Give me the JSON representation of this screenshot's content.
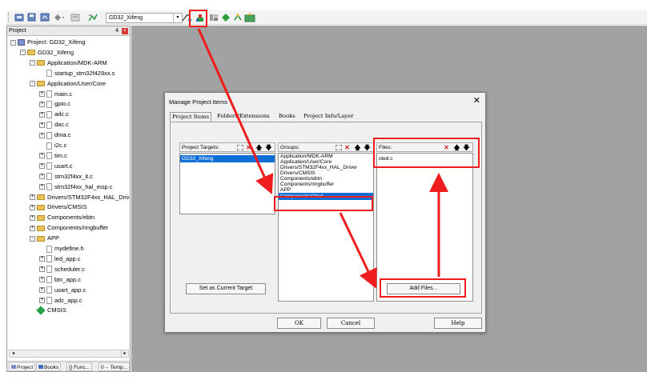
{
  "toolbar": {
    "target": "GD32_Xifeng",
    "icons": [
      "separator-grip-icon",
      "load-icon",
      "save-all-icon",
      "build-icon",
      "dropdown-icon",
      "batch-build-icon",
      "options-icon",
      "manage-project-items-icon",
      "target-options-icon",
      "rebuild-icon",
      "download-icon",
      "debug-icon",
      "pack-installer-icon"
    ]
  },
  "project_panel": {
    "title": "Project",
    "pin": "4",
    "close": "×",
    "tree": [
      {
        "label": "Project: GD32_Xifeng",
        "kind": "project",
        "expander": "-"
      },
      {
        "label": "GD32_Xifeng",
        "kind": "target",
        "expander": "-"
      },
      {
        "label": "Application/MDK-ARM",
        "kind": "folder",
        "expander": "-"
      },
      {
        "label": "startup_stm32f429xx.s",
        "kind": "file",
        "expander": ""
      },
      {
        "label": "Application/User/Core",
        "kind": "folder",
        "expander": "-"
      },
      {
        "label": "main.c",
        "kind": "file",
        "expander": "+"
      },
      {
        "label": "gpio.c",
        "kind": "file",
        "expander": "+"
      },
      {
        "label": "adc.c",
        "kind": "file",
        "expander": "+"
      },
      {
        "label": "dac.c",
        "kind": "file",
        "expander": "+"
      },
      {
        "label": "dma.c",
        "kind": "file",
        "expander": "+"
      },
      {
        "label": "i2c.c",
        "kind": "file",
        "expander": ""
      },
      {
        "label": "tim.c",
        "kind": "file",
        "expander": "+"
      },
      {
        "label": "usart.c",
        "kind": "file",
        "expander": "+"
      },
      {
        "label": "stm32f4xx_it.c",
        "kind": "file",
        "expander": "+"
      },
      {
        "label": "stm32f4xx_hal_msp.c",
        "kind": "file",
        "expander": "+"
      },
      {
        "label": "Drivers/STM32F4xx_HAL_Driv",
        "kind": "folder",
        "expander": "+"
      },
      {
        "label": "Drivers/CMSIS",
        "kind": "folder",
        "expander": "+"
      },
      {
        "label": "Components/ebtn",
        "kind": "folder",
        "expander": "+"
      },
      {
        "label": "Components/ringbuffer",
        "kind": "folder",
        "expander": "+"
      },
      {
        "label": "APP",
        "kind": "folder",
        "expander": "-"
      },
      {
        "label": "mydefine.h",
        "kind": "file",
        "expander": ""
      },
      {
        "label": "led_app.c",
        "kind": "file",
        "expander": "+"
      },
      {
        "label": "scheduler.c",
        "kind": "file",
        "expander": "+"
      },
      {
        "label": "btn_app.c",
        "kind": "file",
        "expander": "+"
      },
      {
        "label": "usart_app.c",
        "kind": "file",
        "expander": "+"
      },
      {
        "label": "adc_app.c",
        "kind": "file",
        "expander": "+"
      },
      {
        "label": "CMSIS",
        "kind": "gem",
        "expander": ""
      }
    ],
    "bottom_tabs": [
      "Project",
      "Books",
      "{} Func...",
      "0→ Temp..."
    ]
  },
  "dialog": {
    "title": "Manage Project Items",
    "close": "✕",
    "tabs": [
      "Project Items",
      "Folders/Extensions",
      "Books",
      "Project Info/Layer"
    ],
    "targets": {
      "header": "Project Targets:",
      "items": [
        "GD32_Xifeng"
      ]
    },
    "groups": {
      "header": "Groups:",
      "items": [
        "Application/MDK-ARM",
        "Application/User/Core",
        "Drivers/STM32F4xx_HAL_Driver",
        "Drivers/CMSIS",
        "Components/ebtn",
        "Components/ringbuffer",
        "APP",
        "Components/Oled"
      ]
    },
    "files": {
      "header": "Files:",
      "items": [
        "oled.c"
      ]
    },
    "buttons": {
      "set_current": "Set as Current Target",
      "add_files": "Add Files...",
      "ok": "OK",
      "cancel": "Cancel",
      "help": "Help"
    },
    "header_glyphs": {
      "new": "",
      "delete": "✕",
      "up": "🡅",
      "down": "🡇"
    }
  },
  "colors": {
    "annotation": "#ef1d1d",
    "selection": "#0f6fd6",
    "workspace": "#a2a2a2"
  }
}
